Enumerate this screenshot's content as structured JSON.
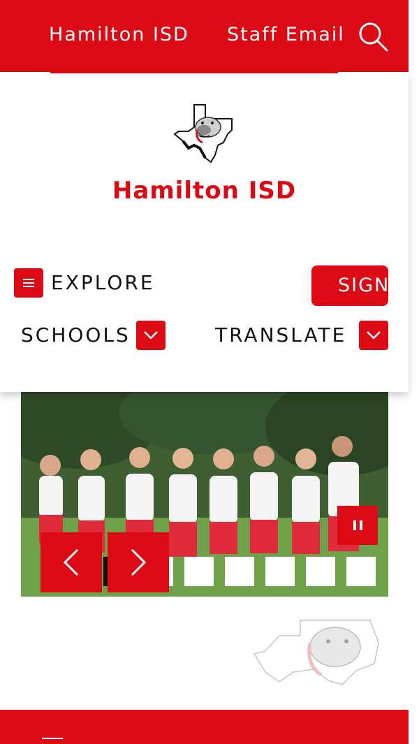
{
  "topbar": {
    "district_link": "Hamilton ISD",
    "staff_email_link": "Staff Email",
    "search_icon": "search-icon",
    "background": "#dc0a14"
  },
  "header": {
    "logo": "bulldog-texas-logo",
    "site_title": "Hamilton ISD",
    "explore_label": "EXPLORE",
    "sign_label": "SIGN",
    "schools_label": "SCHOOLS",
    "translate_label": "TRANSLATE",
    "accent_color": "#dc0a14"
  },
  "slider": {
    "pause_icon": "pause-icon",
    "prev_icon": "chevron-left-icon",
    "next_icon": "chevron-right-icon",
    "total_slides": 7,
    "active_slide": 1
  },
  "footer": {
    "watermark": "bulldog-texas-watermark"
  }
}
